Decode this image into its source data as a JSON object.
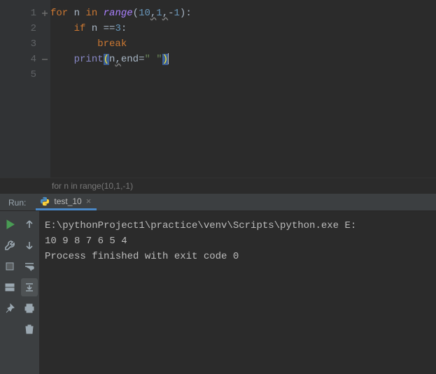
{
  "editor": {
    "lines": [
      "1",
      "2",
      "3",
      "4",
      "5"
    ],
    "code": {
      "l1": {
        "kw1": "for",
        "var": " n ",
        "kw2": "in",
        "sp": " ",
        "fn": "range",
        "lp": "(",
        "a1": "10",
        "c1": ",",
        "a2": "1",
        "c2": ",",
        "a3": "-",
        "a3b": "1",
        "rp": ")",
        "colon": ":"
      },
      "l2": {
        "kw": "if",
        "rest": " n ==",
        "num": "3",
        "colon": ":"
      },
      "l3": {
        "kw": "break"
      },
      "l4": {
        "fn": "print",
        "lp": "(",
        "arg": "n",
        "c": ",",
        "kw": "end",
        "eq": "=",
        "str": "\" \"",
        "rp": ")"
      }
    }
  },
  "breadcrumb": "for n in range(10,1,-1)",
  "run": {
    "label": "Run:",
    "tab": "test_10",
    "tabClose": "×"
  },
  "console": {
    "l1": "E:\\pythonProject1\\practice\\venv\\Scripts\\python.exe E:",
    "l2": "10 9 8 7 6 5 4",
    "l3": "Process finished with exit code 0"
  }
}
